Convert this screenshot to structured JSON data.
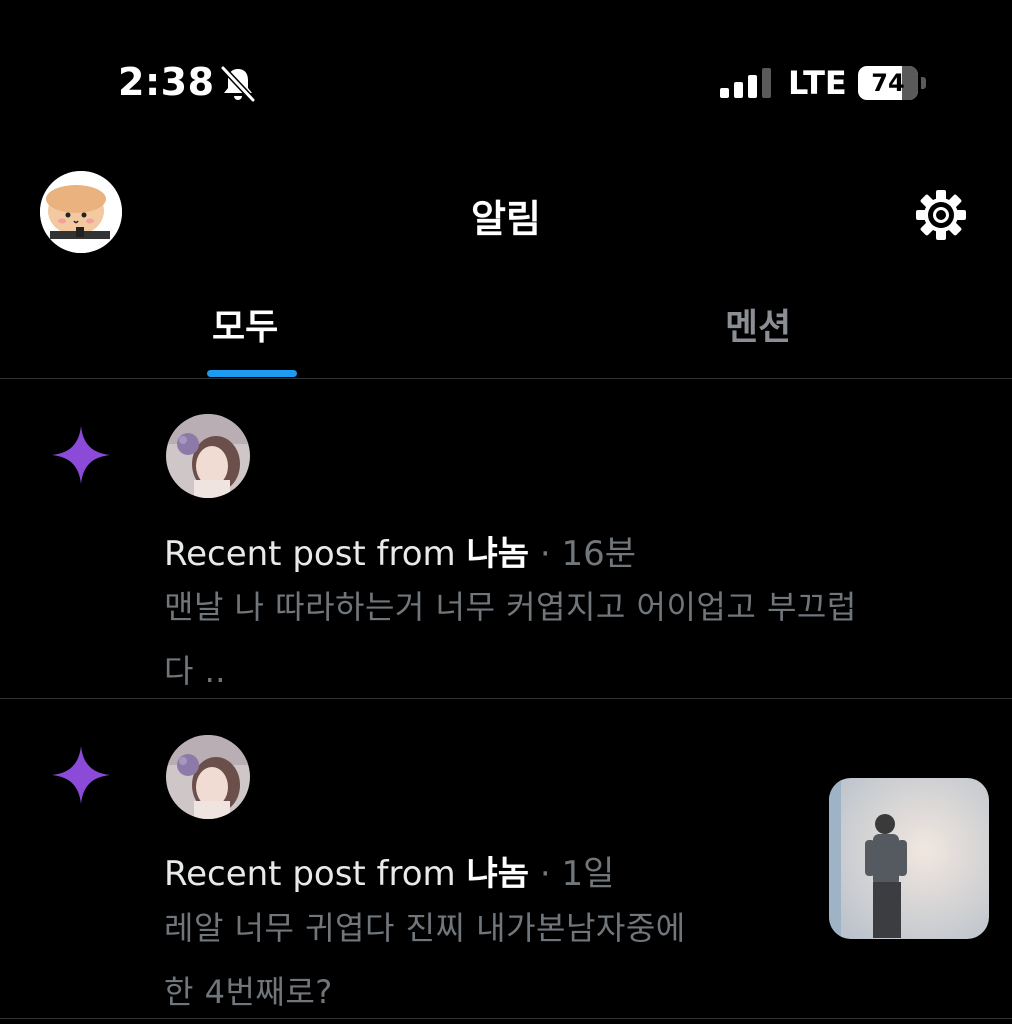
{
  "status_bar": {
    "time": "2:38",
    "network": "LTE",
    "battery": "74",
    "battery_level": 0.74,
    "icons": [
      "bell-muted-icon",
      "cellular-signal-icon",
      "battery-icon"
    ]
  },
  "header": {
    "title": "알림",
    "avatar_icon": "profile-avatar",
    "settings_icon": "gear-icon"
  },
  "tabs": [
    {
      "label": "모두",
      "active": true
    },
    {
      "label": "멘션",
      "active": false
    }
  ],
  "colors": {
    "accent": "#1d9bf0",
    "spark": "#8b4bd8",
    "background": "#000000",
    "secondary_text": "#71767b"
  },
  "notifications": [
    {
      "prefix": "Recent post from",
      "name": "냐놈",
      "sep": "·",
      "time": "16분",
      "preview_1": "맨날 나 따라하는거 너무 커엽지고 어이업고 부끄럽",
      "preview_2": "다 ..",
      "icon": "spark-icon"
    },
    {
      "prefix": "Recent post from",
      "name": "냐놈",
      "sep": "·",
      "time": "1일",
      "preview_1": "레알 너무 귀엽다 진찌 내가본남자중에",
      "preview_2": "한 4번째로?",
      "icon": "spark-icon",
      "has_media": true
    }
  ]
}
